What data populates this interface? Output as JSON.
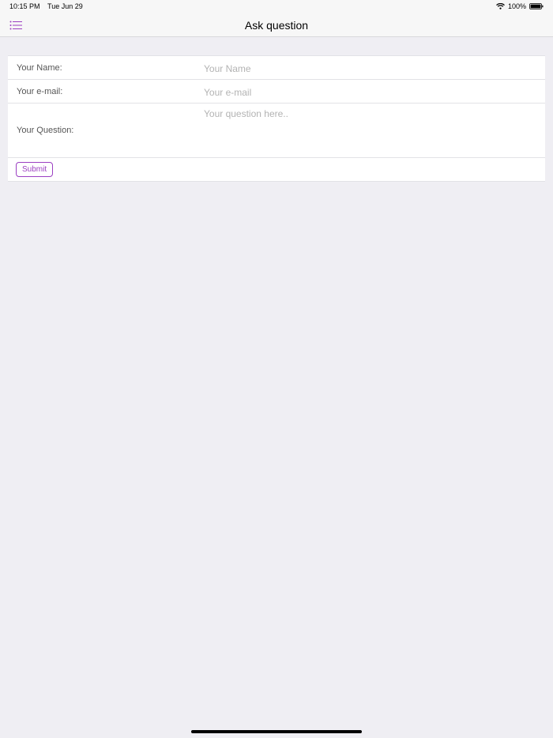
{
  "status_bar": {
    "time": "10:15 PM",
    "date": "Tue Jun 29",
    "battery": "100%"
  },
  "nav": {
    "title": "Ask question",
    "menu_icon": "list-icon"
  },
  "form": {
    "name_label": "Your Name:",
    "name_placeholder": "Your Name",
    "email_label": "Your e-mail:",
    "email_placeholder": "Your e-mail",
    "question_label": "Your Question:",
    "question_placeholder": "Your question here..",
    "submit_label": "Submit"
  },
  "colors": {
    "accent": "#9b3fc2",
    "background": "#efeef3",
    "nav_background": "#f7f7f7"
  }
}
